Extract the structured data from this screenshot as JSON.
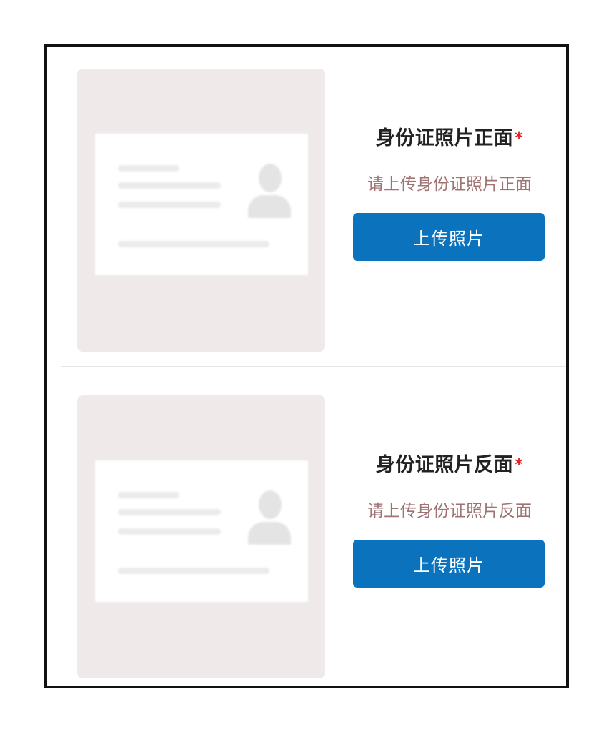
{
  "front": {
    "title": "身份证照片正面",
    "required_mark": "*",
    "hint": "请上传身份证照片正面",
    "button_label": "上传照片"
  },
  "back": {
    "title": "身份证照片反面",
    "required_mark": "*",
    "hint": "请上传身份证照片反面",
    "button_label": "上传照片"
  },
  "colors": {
    "accent": "#0b72bd",
    "required": "#e02020",
    "hint": "#a07373",
    "placeholder_bg": "#efe9e9"
  },
  "icons": {
    "id_card_placeholder": "id-card-placeholder-icon",
    "avatar": "person-avatar-icon"
  }
}
